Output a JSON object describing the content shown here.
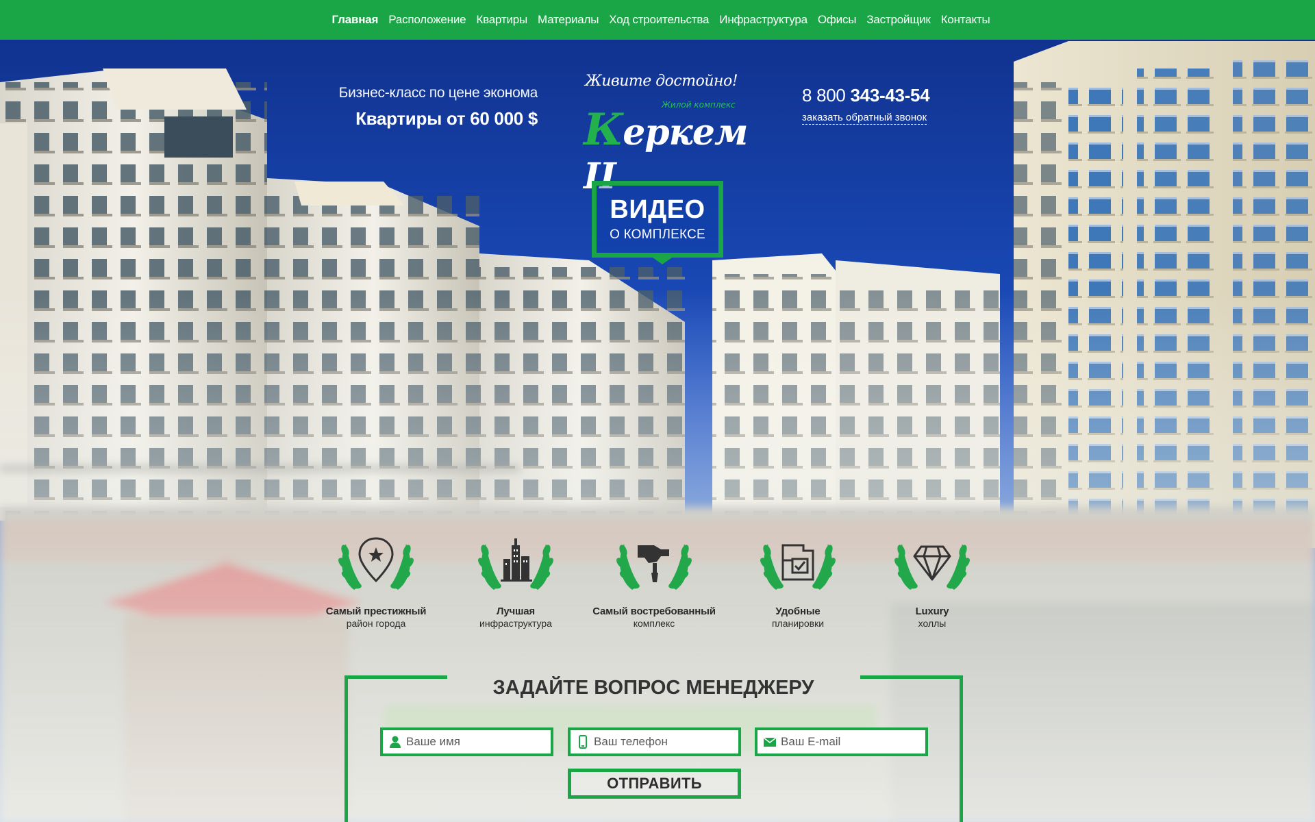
{
  "nav": {
    "items": [
      {
        "label": "Главная",
        "active": true
      },
      {
        "label": "Расположение"
      },
      {
        "label": "Квартиры"
      },
      {
        "label": "Материалы"
      },
      {
        "label": "Ход строительства"
      },
      {
        "label": "Инфраструктура"
      },
      {
        "label": "Офисы"
      },
      {
        "label": "Застройщик"
      },
      {
        "label": "Контакты"
      }
    ]
  },
  "header": {
    "tagline": "Бизнес-класс по цене эконома",
    "price": "Квартиры от 60 000 $",
    "logo": {
      "slogan": "Живите достойно!",
      "subtitle": "Жилой комплекс",
      "name_first": "К",
      "name_rest": "еркем II"
    },
    "phone_prefix": "8 800",
    "phone_main": "343-43-54",
    "callback_link": "заказать обратный звонок"
  },
  "video": {
    "title": "ВИДЕО",
    "subtitle": "О КОМПЛЕКСЕ"
  },
  "features": [
    {
      "icon": "location-star-icon",
      "line1": "Самый престижный",
      "line2": "район города"
    },
    {
      "icon": "city-buildings-icon",
      "line1": "Лучшая",
      "line2": "инфраструктура"
    },
    {
      "icon": "hand-award-icon",
      "line1": "Самый востребованный",
      "line2": "комплекс"
    },
    {
      "icon": "floor-plan-icon",
      "line1": "Удобные",
      "line2": "планировки"
    },
    {
      "icon": "diamond-icon",
      "line1": "Luxury",
      "line2": "холлы"
    }
  ],
  "form": {
    "title": "ЗАДАЙТЕ ВОПРОС МЕНЕДЖЕРУ",
    "name_placeholder": "Ваше имя",
    "phone_placeholder": "Ваш телефон",
    "email_placeholder": "Ваш E-mail",
    "submit_label": "ОТПРАВИТЬ"
  },
  "colors": {
    "accent": "#1aa546",
    "sky": "#1a3fa0"
  }
}
